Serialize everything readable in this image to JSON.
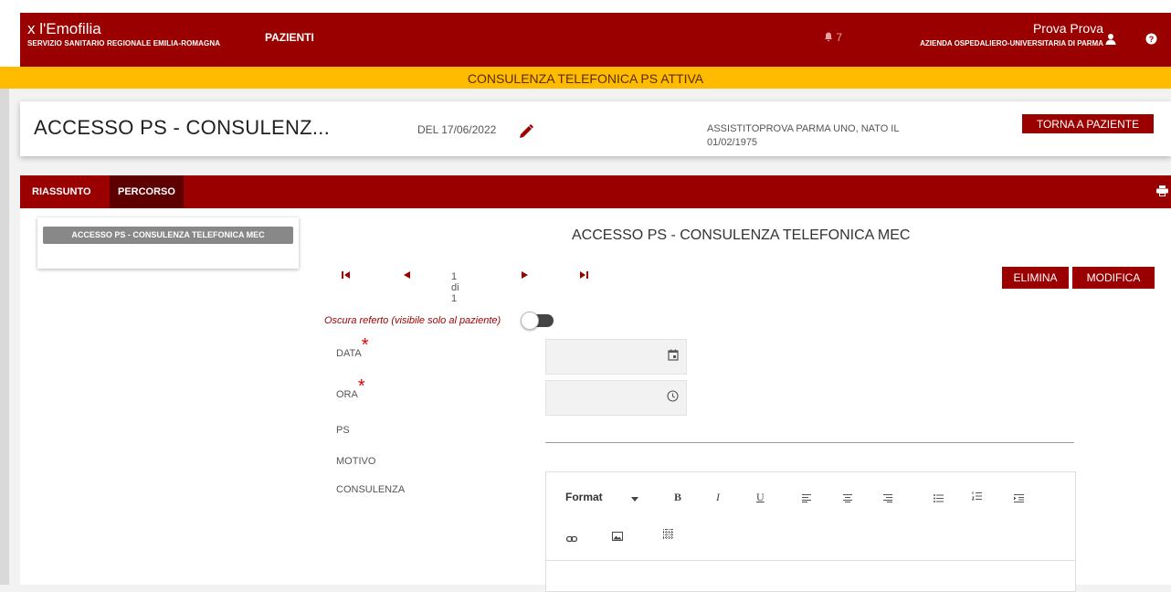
{
  "nav": {
    "brand_title": "x l'Emofilia",
    "brand_subtitle": "SERVIZIO SANITARIO REGIONALE EMILIA-ROMAGNA",
    "menu_pazienti": "PAZIENTI",
    "notifications_count": "7",
    "user_name": "Prova Prova",
    "user_azienda": "AZIENDA OSPEDALIERO-UNIVERSITARIA DI PARMA"
  },
  "banner": {
    "text": "CONSULENZA TELEFONICA PS ATTIVA"
  },
  "header": {
    "title": "ACCESSO PS - CONSULENZ...",
    "date": "DEL 17/06/2022",
    "patient": "ASSISTITOPROVA PARMA UNO, NATO IL 01/02/1975",
    "back_button": "TORNA A PAZIENTE"
  },
  "tabs": [
    {
      "label": "RIASSUNTO"
    },
    {
      "label": "PERCORSO"
    }
  ],
  "sidebar": {
    "item": "ACCESSO PS - CONSULENZA TELEFONICA MEC"
  },
  "detail": {
    "title": "ACCESSO PS - CONSULENZA TELEFONICA MEC",
    "pager": "1 di 1",
    "elimina": "ELIMINA",
    "modifica": "MODIFICA",
    "oscura_label": "Oscura referto (visibile solo al paziente)",
    "oscura_on": false,
    "fields": {
      "data_label": "DATA",
      "data_value": "",
      "ora_label": "ORA",
      "ora_value": "",
      "ps_label": "PS",
      "motivo_label": "MOTIVO",
      "consulenza_label": "CONSULENZA"
    },
    "editor": {
      "format_label": "Format",
      "bold": "B",
      "italic": "I",
      "underline": "U"
    }
  },
  "colors": {
    "primary": "#9b0000",
    "banner": "#ffbb00",
    "tab_active": "#5e0000"
  }
}
